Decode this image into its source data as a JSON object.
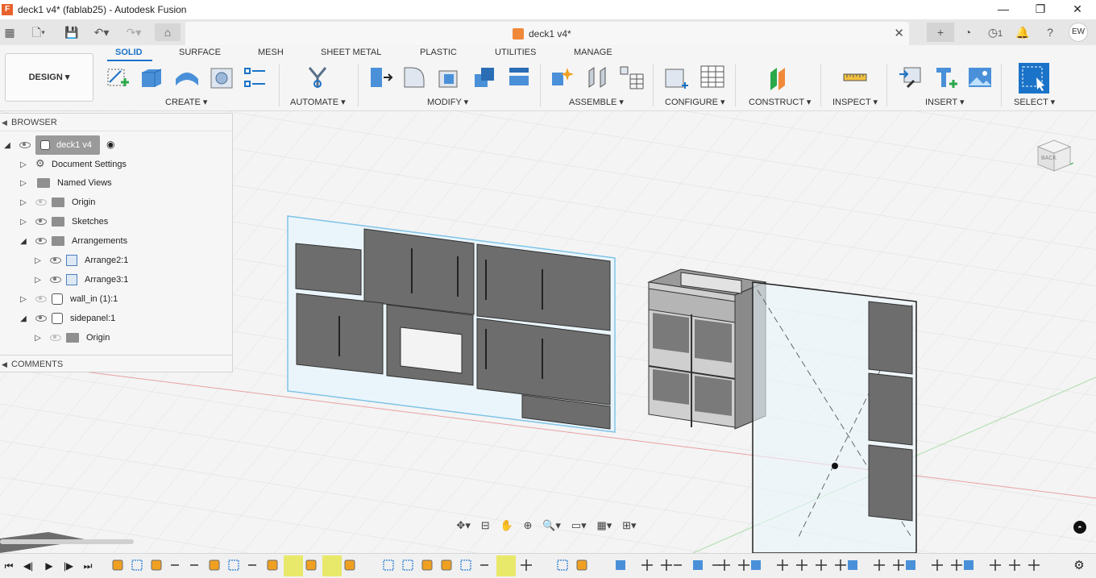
{
  "window": {
    "title": "deck1 v4* (fablab25) - Autodesk Fusion",
    "app_icon": "F",
    "controls": [
      "—",
      "❐",
      "✕"
    ]
  },
  "document_tab": {
    "name": "deck1 v4*",
    "close": "✕"
  },
  "user": {
    "initials": "EW"
  },
  "toolbar": {
    "notifications_count": "1"
  },
  "workspace": {
    "label": "DESIGN ▾"
  },
  "ribbon": {
    "tabs": [
      "SOLID",
      "SURFACE",
      "MESH",
      "SHEET METAL",
      "PLASTIC",
      "UTILITIES",
      "MANAGE"
    ],
    "active_tab": "SOLID",
    "groups": [
      "CREATE ▾",
      "AUTOMATE ▾",
      "MODIFY ▾",
      "ASSEMBLE ▾",
      "CONFIGURE ▾",
      "CONSTRUCT ▾",
      "INSPECT ▾",
      "INSERT ▾",
      "SELECT ▾"
    ]
  },
  "browser": {
    "title": "BROWSER",
    "items": [
      {
        "label": "deck1 v4",
        "icon": "component-icon"
      },
      {
        "label": "Document Settings",
        "icon": "gear-icon"
      },
      {
        "label": "Named Views",
        "icon": "folder-icon"
      },
      {
        "label": "Origin",
        "icon": "folder-icon"
      },
      {
        "label": "Sketches",
        "icon": "folder-icon"
      },
      {
        "label": "Arrangements",
        "icon": "folder-icon"
      },
      {
        "label": "Arrange2:1",
        "icon": "arrangement-icon"
      },
      {
        "label": "Arrange3:1",
        "icon": "arrangement-icon"
      },
      {
        "label": "wall_in (1):1",
        "icon": "component-icon"
      },
      {
        "label": "sidepanel:1",
        "icon": "component-icon"
      },
      {
        "label": "Origin",
        "icon": "folder-icon"
      }
    ]
  },
  "comments": {
    "title": "COMMENTS"
  },
  "viewcube": {
    "face_label": "BACK"
  },
  "colors": {
    "accent": "#1a73c8",
    "panel_gray": "#6f6f6f",
    "sketch_blue": "#7fc3e8",
    "grid": "#dcdcdc"
  }
}
